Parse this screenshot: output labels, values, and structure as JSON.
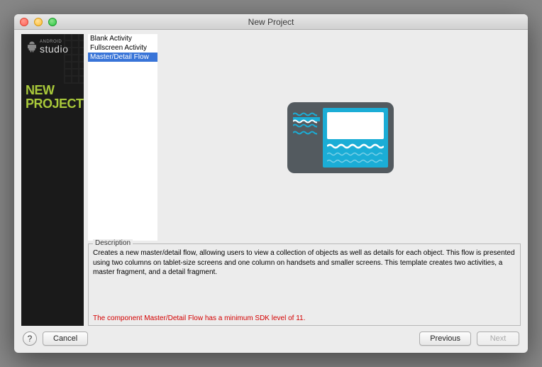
{
  "window": {
    "title": "New Project"
  },
  "sidebar": {
    "brand_line1": "ANDROID",
    "brand_line2": "studio",
    "heading_line1": "NEW",
    "heading_line2": "PROJECT"
  },
  "templates": {
    "items": [
      {
        "label": "Blank Activity",
        "selected": false
      },
      {
        "label": "Fullscreen Activity",
        "selected": false
      },
      {
        "label": "Master/Detail Flow",
        "selected": true
      }
    ]
  },
  "description": {
    "label": "Description",
    "text": "Creates a new master/detail flow, allowing users to view a collection of objects as well as details for each object. This flow is presented using two columns on tablet-size screens and one column on handsets and smaller screens. This template creates two activities, a master fragment, and a detail fragment.",
    "warning": "The component Master/Detail Flow has a minimum SDK level of 11."
  },
  "buttons": {
    "help": "?",
    "cancel": "Cancel",
    "previous": "Previous",
    "next": "Next"
  },
  "colors": {
    "accent_green": "#a9c93a",
    "preview_cyan": "#1badd6",
    "selection_blue": "#3874d8",
    "warning_red": "#d40000"
  }
}
